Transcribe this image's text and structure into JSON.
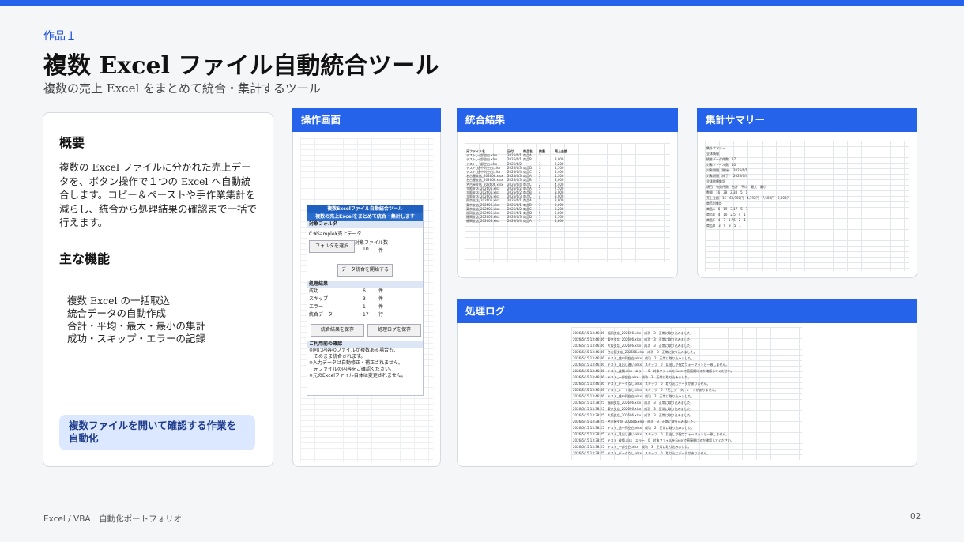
{
  "header": {
    "kicker": "作品１",
    "title": "複数 Excel ファイル自動統合ツール",
    "subtitle": "複数の売上 Excel をまとめて統合・集計するツール"
  },
  "overview": {
    "heading": "概要",
    "description": "複数の Excel ファイルに分かれた売上データを、ボタン操作で１つの Excel へ自動統合します。コピー＆ペーストや手作業集計を減らし、統合から処理結果の確認まで一括で行えます。",
    "features_heading": "主な機能",
    "features": [
      "複数 Excel の一括取込",
      "統合データの自動作成",
      "合計・平均・最大・最小の集計",
      "成功・スキップ・エラーの記録"
    ],
    "badge": "複数ファイルを開いて確認する作業を自動化"
  },
  "panels": {
    "operation": "操作画面",
    "result": "統合結果",
    "summary": "集計サマリー",
    "log": "処理ログ"
  },
  "form": {
    "title": "複数Excelファイル自動統合ツール",
    "subtitle": "複数の売上Excelをまとめて統合・集計します",
    "folder_section": "対象フォルダ",
    "folder_path": "C:¥Sample¥売上データ",
    "select_folder_button": "フォルダを選択",
    "file_count_label": "対象ファイル数",
    "file_count_value": "10",
    "unit_files": "件",
    "start_button": "データ統合を開始する",
    "result_section": "処理結果",
    "results": [
      {
        "label": "成功",
        "value": "6",
        "unit": "件"
      },
      {
        "label": "スキップ",
        "value": "3",
        "unit": "件"
      },
      {
        "label": "エラー",
        "value": "1",
        "unit": "件"
      },
      {
        "label": "統合データ",
        "value": "17",
        "unit": "行"
      }
    ],
    "save_result_button": "統合結果を保存",
    "save_log_button": "処理ログを保存",
    "notes_section": "ご利用前の確認",
    "notes": [
      "※同じ内容のファイルが複数ある場合も、",
      "　そのまま統合されます。",
      "※入力データは自動修正・補正されません。",
      "　元ファイルの内容をご確認ください。",
      "※元のExcelファイル自体は変更されません。"
    ]
  },
  "result_sheet": {
    "headers": [
      "元ファイル名",
      "日付",
      "商品名",
      "数量",
      "売上金額"
    ],
    "rows": [
      [
        "テスト_一部空白.xlsx",
        "2026/6/1",
        "商品A",
        "3",
        ""
      ],
      [
        "テスト_一部空白.xlsx",
        "2026/6/1",
        "商品B",
        "",
        "3,000"
      ],
      [
        "テスト_一部空白.xlsx",
        "2026/6/2",
        "",
        "1",
        "2,200"
      ],
      [
        "テスト_途中列空白.xlsx",
        "2026/6/3",
        "商品D",
        "3",
        "4,500"
      ],
      [
        "テスト_途中列空白.xlsx",
        "2026/6/4",
        "商品C",
        "2",
        "4,400"
      ],
      [
        "名古屋支店_202606.xlsx",
        "2026/6/3",
        "商品A",
        "5",
        "1,500"
      ],
      [
        "名古屋支店_202606.xlsx",
        "2026/6/3",
        "商品B",
        "1",
        "3,000"
      ],
      [
        "名古屋支店_202606.xlsx",
        "2026/6/4",
        "商品C",
        "2",
        "4,400"
      ],
      [
        "大阪支店_202606.xlsx",
        "2026/6/2",
        "商品A",
        "5",
        "7,500"
      ],
      [
        "大阪支店_202606.xlsx",
        "2026/6/2",
        "商品B",
        "4",
        "8,000"
      ],
      [
        "大阪支店_202606.xlsx",
        "2026/6/3",
        "商品C",
        "4",
        "8,000"
      ],
      [
        "東京支店_202606.xlsx",
        "2026/6/1",
        "商品A",
        "2",
        "3,000"
      ],
      [
        "東京支店_202606.xlsx",
        "2026/6/1",
        "商品B",
        "3",
        "3,000"
      ],
      [
        "東京支店_202606.xlsx",
        "2026/6/2",
        "商品C",
        "1",
        "2,200"
      ],
      [
        "福岡支店_202606.xlsx",
        "2026/6/1",
        "商品D",
        "5",
        "5,600"
      ],
      [
        "福岡支店_202606.xlsx",
        "2026/6/3",
        "商品D",
        "1",
        "4,500"
      ],
      [
        "福岡支店_202606.xlsx",
        "2026/6/4",
        "商品A",
        "1",
        "4,800"
      ]
    ]
  },
  "log_sheet": {
    "rows": [
      "2026/5/15 13:46:46　福岡支店_202606.xlsx　成功　3　正常に取り込みました。",
      "2026/5/15 13:46:46　東京支店_202606.xlsx　成功　3　正常に取り込みました。",
      "2026/5/15 13:46:46　大阪支店_202606.xlsx　成功　3　正常に取り込みました。",
      "2026/5/15 13:46:46　名古屋支店_202606.xlsx　成功　3　正常に取り込みました。",
      "2026/5/15 13:46:46　テスト_途中列空白.xlsx　成功　2　正常に取り込みました。",
      "2026/5/15 13:46:46　テスト_見出し違い.xlsx　スキップ　0　見出しが指定フォーマットと一致しません。",
      "2026/5/15 13:46:46　テスト_破損.xlsx　エラー　0　対象ファイルをExcelで直接開けるか確認してください。",
      "2026/5/15 13:46:46　テスト_一部空白.xlsx　成功　3　正常に取り込みました。",
      "2026/5/15 13:46:46　テスト_データなし.xlsx　スキップ　0　取り込むデータがありません。",
      "2026/5/15 13:46:46　テスト_シートなし.xlsx　スキップ　0　「売上データ」シートがありません。",
      "2026/5/15 13:46:46　テスト_途中列空白.xlsx　成功　2　正常に取り込みました。",
      "2026/5/15 13:38:25　福岡支店_202606.xlsx　成功　3　正常に取り込みました。",
      "2026/5/15 13:38:25　東京支店_202606.xlsx　成功　3　正常に取り込みました。",
      "2026/5/15 13:38:25　大阪支店_202606.xlsx　成功　3　正常に取り込みました。",
      "2026/5/15 13:38:25　名古屋支店_202606.xlsx　成功　3　正常に取り込みました。",
      "2026/5/15 13:38:25　テスト_途中列空白.xlsx　成功　2　正常に取り込みました。",
      "2026/5/15 13:38:25　テスト_見出し違い.xlsx　スキップ　0　見出しが指定フォーマットと一致しません。",
      "2026/5/15 13:38:25　テスト_破損.xlsx　エラー　0　対象ファイルをExcelで直接開けるか確認してください。",
      "2026/5/15 13:38:25　テスト_一部空白.xlsx　成功　3　正常に取り込みました。",
      "2026/5/15 13:38:25　テスト_データなし.xlsx　スキップ　0　取り込むデータがありません。"
    ]
  },
  "summary_sheet": {
    "rows": [
      "集計サマリー",
      "全体情報",
      "統合データ件数　17",
      "対象ファイル数　10",
      "対象期間（開始）　2026/6/1",
      "対象期間（終了）　2026/6/4",
      "全体数値集計",
      "項目　有効件数　合計　平均　最大　最小",
      "数量　16　38　2.38　5　1",
      "売上金額　16　60,900円　4,192円　7,500円　2,000円",
      "商品別集計",
      "商品A　6　19　3.17　5　1",
      "商品B　4　10　2.5　4　1",
      "商品C　4　7　1.75　2　1",
      "商品D　3　9　3　5　1"
    ]
  },
  "footer": {
    "left": "Excel / VBA　自動化ポートフォリオ",
    "page": "02"
  },
  "colors": {
    "accent": "#2563eb",
    "badge_bg": "#dbe8ff"
  }
}
